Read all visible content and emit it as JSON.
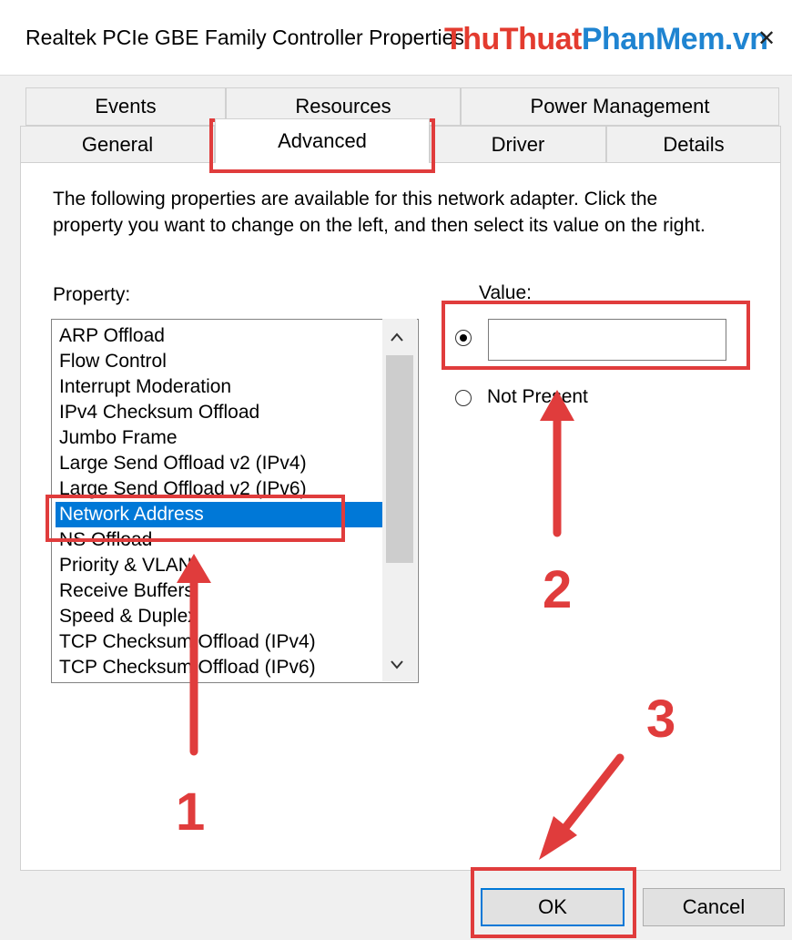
{
  "window": {
    "title": "Realtek PCIe GBE Family Controller Properties",
    "close_glyph": "✕",
    "watermark_part1": "ThuThuat",
    "watermark_part2": "PhanMem.vn"
  },
  "tabs_row1": [
    "Events",
    "Resources",
    "Power Management"
  ],
  "tabs_row2": [
    "General",
    "Advanced",
    "Driver",
    "Details"
  ],
  "active_tab": "Advanced",
  "description": "The following properties are available for this network adapter. Click the property you want to change on the left, and then select its value on the right.",
  "property_label": "Property:",
  "value_label": "Value:",
  "properties": [
    "ARP Offload",
    "Flow Control",
    "Interrupt Moderation",
    "IPv4 Checksum Offload",
    "Jumbo Frame",
    "Large Send Offload v2 (IPv4)",
    "Large Send Offload v2 (IPv6)",
    "Network Address",
    "NS Offload",
    "Priority & VLAN",
    "Receive Buffers",
    "Speed & Duplex",
    "TCP Checksum Offload (IPv4)",
    "TCP Checksum Offload (IPv6)"
  ],
  "selected_property": "Network Address",
  "value_input": {
    "value": "",
    "selected": true
  },
  "not_present_label": "Not Present",
  "buttons": {
    "ok": "OK",
    "cancel": "Cancel"
  },
  "annotations": {
    "step1": "1",
    "step2": "2",
    "step3": "3",
    "color": "#e03c3c"
  },
  "scroll_icons": {
    "up": "chevron-up-icon",
    "down": "chevron-down-icon"
  },
  "colors": {
    "selection": "#0078d7",
    "button": "#e1e1e1"
  }
}
